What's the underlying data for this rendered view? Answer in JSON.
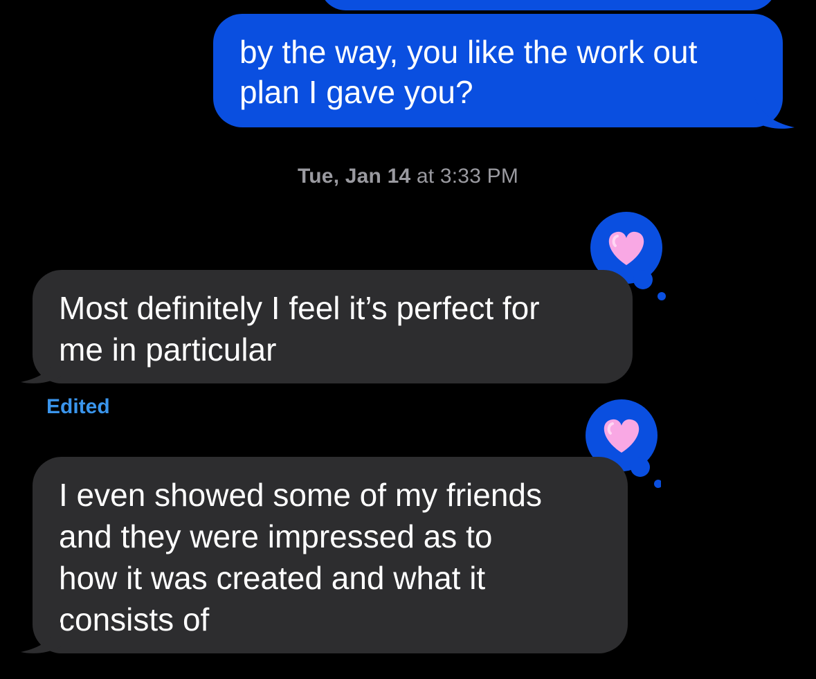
{
  "conversation": {
    "messages": [
      {
        "direction": "outgoing",
        "lines": [
          "by the way, you like the work out",
          "plan I gave you?"
        ]
      }
    ],
    "timestamp": {
      "day": "Tue, Jan 14",
      "at": "at",
      "time": "3:33 PM"
    },
    "incoming": [
      {
        "lines": [
          "Most definitely I feel it’s perfect for",
          "me in particular"
        ],
        "reaction": "heart-tapback-icon"
      },
      {
        "lines": [
          "I even showed some of my friends",
          "and they were impressed as to",
          "how it was created and what it",
          "consists of"
        ],
        "reaction": "heart-tapback-icon"
      }
    ],
    "edited_label": "Edited"
  },
  "colors": {
    "outgoing_bubble": "#0a4fe0",
    "incoming_bubble": "#2d2d2f",
    "timestamp_text": "#9a9aa0",
    "edited_text": "#3a95ec",
    "heart": "#f9a8e4"
  }
}
